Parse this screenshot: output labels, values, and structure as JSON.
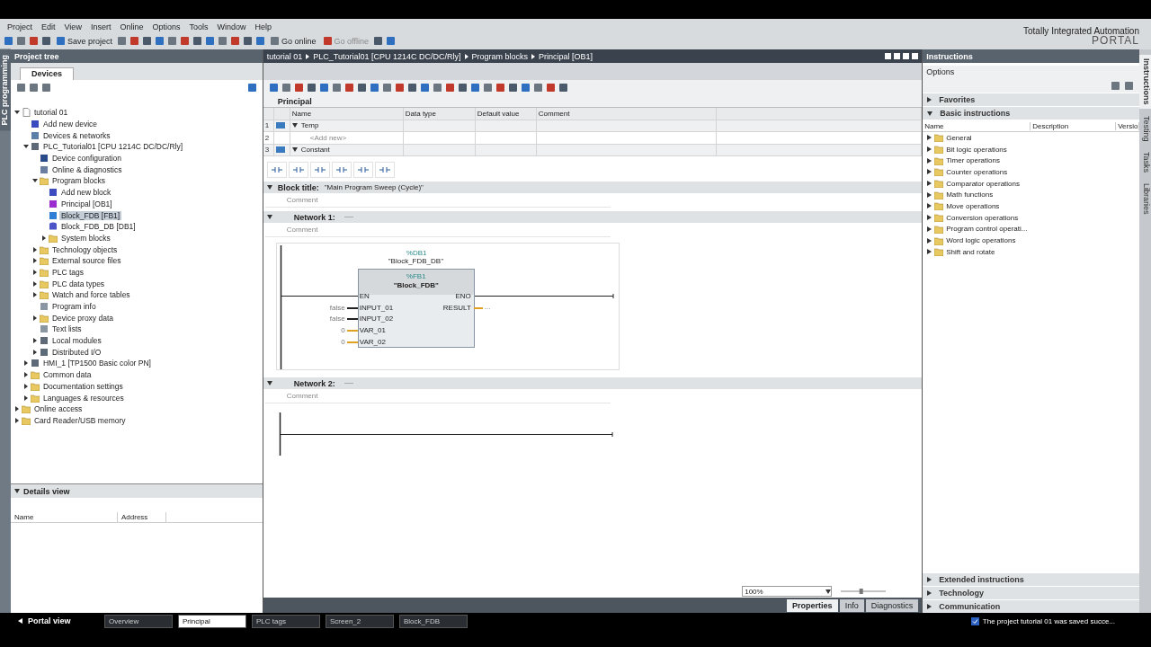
{
  "menu": [
    "Project",
    "Edit",
    "View",
    "Insert",
    "Online",
    "Options",
    "Tools",
    "Window",
    "Help"
  ],
  "toolbar": [
    {
      "label": "Save project",
      "disabled": false
    },
    {
      "label": "Go online",
      "disabled": false
    },
    {
      "label": "Go offline",
      "disabled": true
    }
  ],
  "branding": {
    "line1": "Totally Integrated Automation",
    "line2": "PORTAL"
  },
  "side_tab": "PLC programming",
  "project_tree": {
    "title": "Project tree",
    "tab": "Devices",
    "items": [
      {
        "label": "tutorial 01",
        "kind": "page",
        "expanded": true,
        "selected": false,
        "children": [
          {
            "label": "Add new device",
            "kind": "add",
            "selected": false
          },
          {
            "label": "Devices & networks",
            "kind": "network",
            "selected": false
          },
          {
            "label": "PLC_Tutorial01 [CPU 1214C DC/DC/Rly]",
            "kind": "device",
            "expanded": true,
            "selected": false,
            "children": [
              {
                "label": "Device configuration",
                "kind": "config",
                "selected": false
              },
              {
                "label": "Online & diagnostics",
                "kind": "diag",
                "selected": false
              },
              {
                "label": "Program blocks",
                "kind": "folder",
                "expanded": true,
                "selected": false,
                "children": [
                  {
                    "label": "Add new block",
                    "kind": "add",
                    "selected": false
                  },
                  {
                    "label": "Principal [OB1]",
                    "kind": "ob",
                    "selected": false
                  },
                  {
                    "label": "Block_FDB [FB1]",
                    "kind": "fb",
                    "selected": true
                  },
                  {
                    "label": "Block_FDB_DB [DB1]",
                    "kind": "db",
                    "selected": false
                  },
                  {
                    "label": "System blocks",
                    "kind": "folder",
                    "expanded": false,
                    "selected": false
                  }
                ]
              },
              {
                "label": "Technology objects",
                "kind": "folder",
                "expanded": false,
                "selected": false
              },
              {
                "label": "External source files",
                "kind": "folder",
                "expanded": false,
                "selected": false
              },
              {
                "label": "PLC tags",
                "kind": "folder",
                "expanded": false,
                "selected": false
              },
              {
                "label": "PLC data types",
                "kind": "folder",
                "expanded": false,
                "selected": false
              },
              {
                "label": "Watch and force tables",
                "kind": "folder",
                "expanded": false,
                "selected": false
              },
              {
                "label": "Program info",
                "kind": "list",
                "selected": false
              },
              {
                "label": "Device proxy data",
                "kind": "folder",
                "expanded": false,
                "selected": false
              },
              {
                "label": "Text lists",
                "kind": "list",
                "selected": false
              },
              {
                "label": "Local modules",
                "kind": "device",
                "expanded": false,
                "selected": false
              },
              {
                "label": "Distributed I/O",
                "kind": "device",
                "expanded": false,
                "selected": false
              }
            ]
          },
          {
            "label": "HMI_1 [TP1500 Basic color PN]",
            "kind": "device",
            "expanded": false,
            "selected": false
          },
          {
            "label": "Common data",
            "kind": "folder",
            "expanded": false,
            "selected": false
          },
          {
            "label": "Documentation settings",
            "kind": "folder",
            "expanded": false,
            "selected": false
          },
          {
            "label": "Languages & resources",
            "kind": "folder",
            "expanded": false,
            "selected": false
          }
        ]
      },
      {
        "label": "Online access",
        "kind": "folder",
        "expanded": false,
        "selected": false
      },
      {
        "label": "Card Reader/USB memory",
        "kind": "folder",
        "expanded": false,
        "selected": false
      }
    ]
  },
  "details_view": {
    "title": "Details view",
    "columns": [
      "Name",
      "Address"
    ]
  },
  "editor": {
    "breadcrumb": [
      "tutorial 01",
      "PLC_Tutorial01 [CPU 1214C DC/DC/Rly]",
      "Program blocks",
      "Principal [OB1]"
    ],
    "interface": {
      "title": "Principal",
      "columns": [
        "Name",
        "Data type",
        "Default value",
        "Comment"
      ],
      "rows": [
        {
          "number": "1",
          "name": "Temp",
          "kind": "section"
        },
        {
          "number": "2",
          "name": "<Add new>",
          "kind": "add"
        },
        {
          "number": "3",
          "name": "Constant",
          "kind": "section"
        }
      ]
    },
    "block_title": {
      "label": "Block title:",
      "value": "\"Main Program Sweep (Cycle)\"",
      "comment": "Comment"
    },
    "networks": [
      {
        "title": "Network 1:",
        "comment": "Comment",
        "block": {
          "instance": "%DB1",
          "instance_name": "\"Block_FDB_DB\"",
          "address": "%FB1",
          "name": "\"Block_FDB\"",
          "inputs": [
            {
              "pin": "EN",
              "kind": "power"
            },
            {
              "pin": "INPUT_01",
              "value": "false",
              "kind": "bool"
            },
            {
              "pin": "INPUT_02",
              "value": "false",
              "kind": "bool"
            },
            {
              "pin": "VAR_01",
              "value": "0",
              "kind": "int"
            },
            {
              "pin": "VAR_02",
              "value": "0",
              "kind": "int"
            }
          ],
          "outputs": [
            {
              "pin": "ENO",
              "kind": "power"
            },
            {
              "pin": "RESULT",
              "value": "...",
              "kind": "int"
            }
          ]
        }
      },
      {
        "title": "Network 2:",
        "comment": "Comment"
      }
    ],
    "zoom": "100%",
    "zoom_slider": {
      "level": 0.45
    },
    "inspector_tabs": [
      {
        "label": "Properties",
        "selected": true
      },
      {
        "label": "Info",
        "selected": false
      },
      {
        "label": "Diagnostics",
        "selected": false
      }
    ]
  },
  "instructions": {
    "title": "Instructions",
    "options": "Options",
    "sections": [
      {
        "label": "Favorites",
        "expanded": false
      },
      {
        "label": "Basic instructions",
        "expanded": true
      }
    ],
    "columns": [
      "Name",
      "Description",
      "Versio"
    ],
    "items": [
      "General",
      "Bit logic operations",
      "Timer operations",
      "Counter operations",
      "Comparator operations",
      "Math functions",
      "Move operations",
      "Conversion operations",
      "Program control operati...",
      "Word logic operations",
      "Shift and rotate"
    ],
    "bottom_sections": [
      {
        "label": "Extended instructions",
        "expanded": false
      },
      {
        "label": "Technology",
        "expanded": false
      },
      {
        "label": "Communication",
        "expanded": false
      }
    ]
  },
  "right_tabs": [
    {
      "label": "Instructions",
      "selected": true
    },
    {
      "label": "Testing",
      "selected": false
    },
    {
      "label": "Tasks",
      "selected": false
    },
    {
      "label": "Libraries",
      "selected": false
    }
  ],
  "taskbar": {
    "portal": "Portal view",
    "tabs": [
      {
        "label": "Overview",
        "selected": false
      },
      {
        "label": "Principal",
        "selected": true
      },
      {
        "label": "PLC tags",
        "selected": false
      },
      {
        "label": "Screen_2",
        "selected": false
      },
      {
        "label": "Block_FDB",
        "selected": false
      }
    ],
    "status": "The project tutorial 01 was saved succe..."
  }
}
